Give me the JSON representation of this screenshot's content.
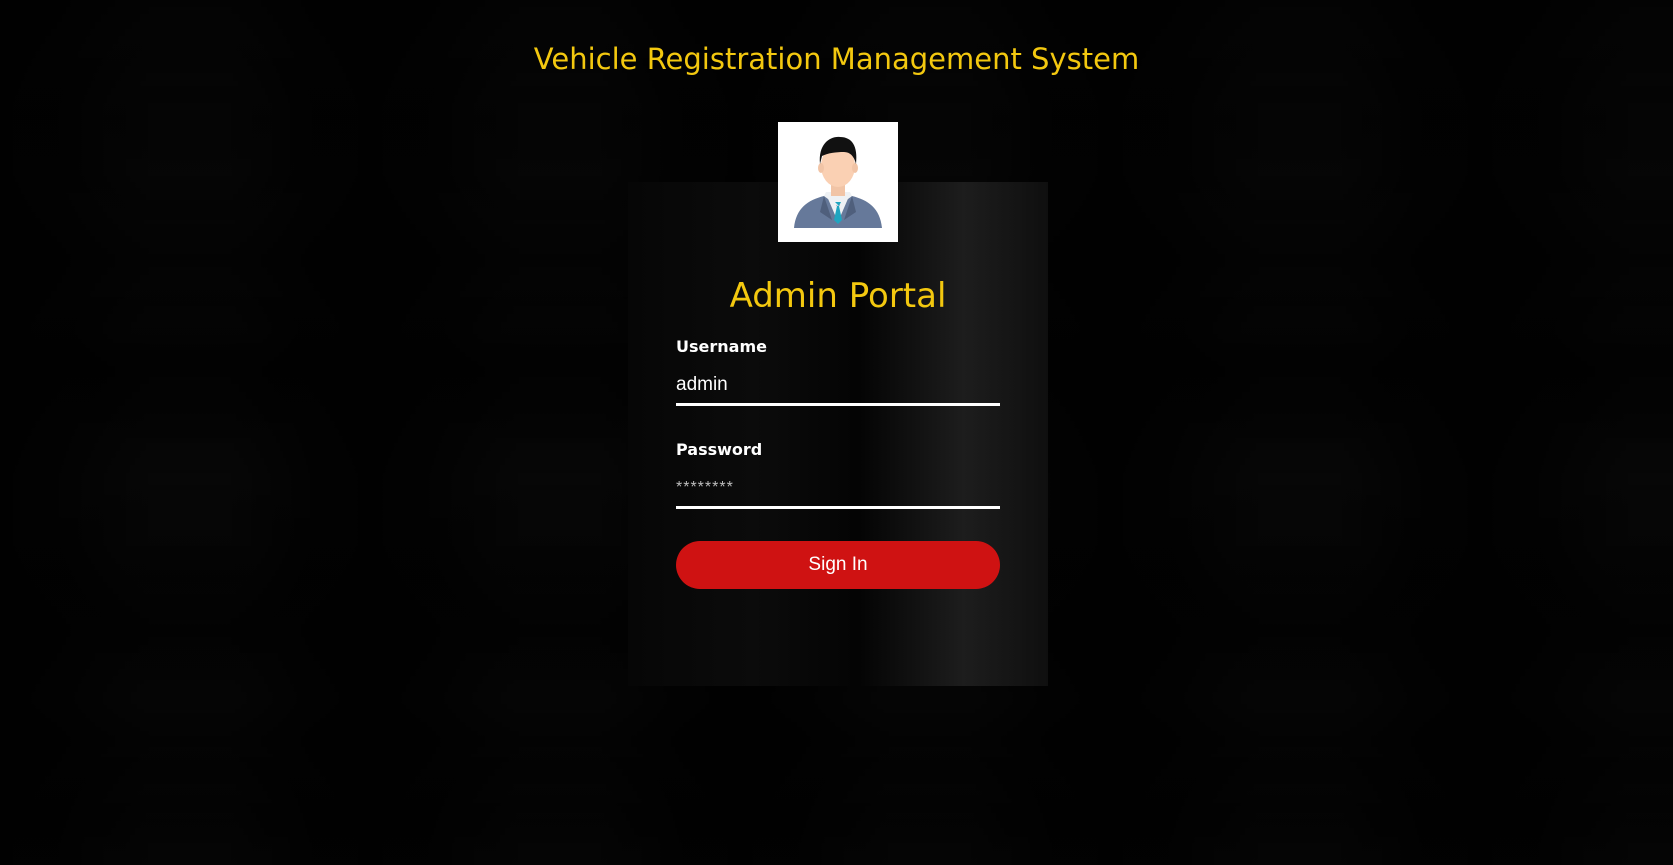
{
  "header": {
    "title": "Vehicle Registration Management System"
  },
  "avatar": {
    "icon": "admin-avatar-icon"
  },
  "login": {
    "title": "Admin Portal",
    "username_label": "Username",
    "username_value": "admin",
    "password_label": "Password",
    "password_value": "********",
    "signin_label": "Sign In"
  },
  "colors": {
    "accent": "#f3c80f",
    "button": "#cf1212",
    "panel": "#060606"
  }
}
